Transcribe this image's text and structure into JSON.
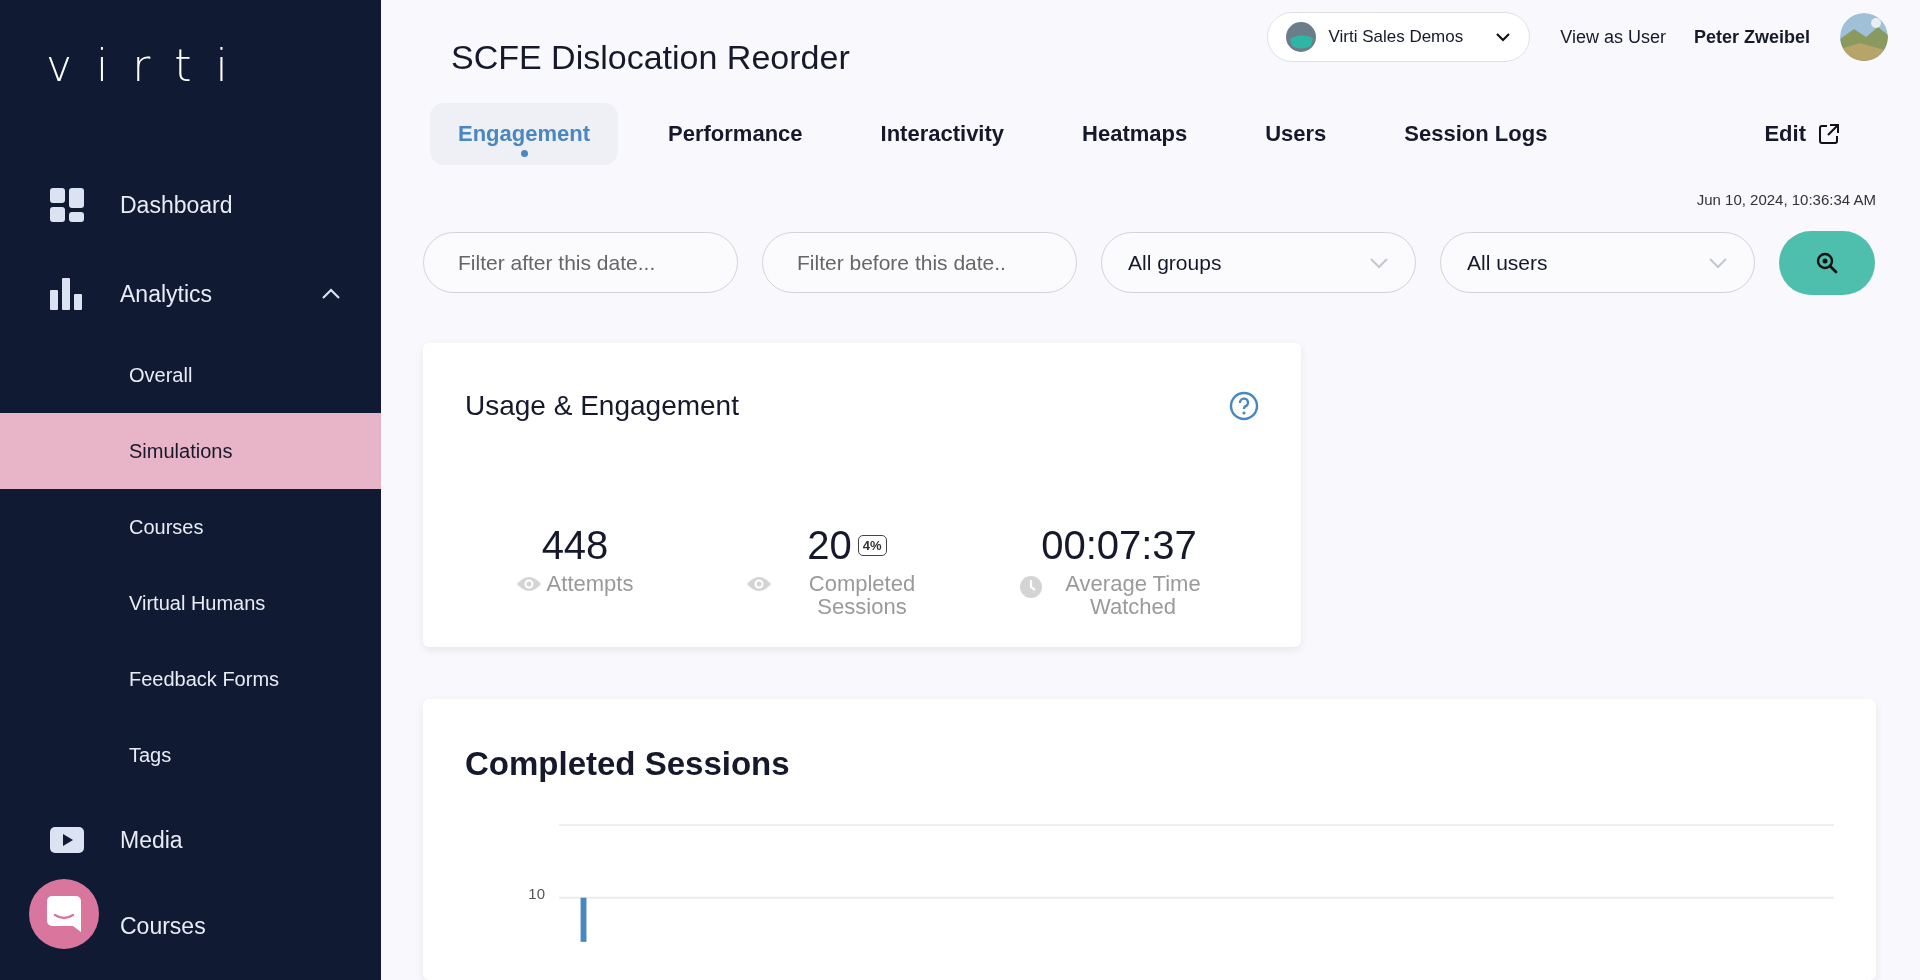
{
  "sidebar": {
    "logo": "virti",
    "items": [
      {
        "label": "Dashboard"
      },
      {
        "label": "Analytics",
        "expanded": true,
        "children": [
          {
            "label": "Overall",
            "selected": false
          },
          {
            "label": "Simulations",
            "selected": true
          },
          {
            "label": "Courses",
            "selected": false
          },
          {
            "label": "Virtual Humans",
            "selected": false
          },
          {
            "label": "Feedback Forms",
            "selected": false
          },
          {
            "label": "Tags",
            "selected": false
          }
        ]
      },
      {
        "label": "Media"
      },
      {
        "label": "Courses"
      }
    ]
  },
  "header": {
    "title": "SCFE Dislocation Reorder",
    "org_selector": "Virti Sales Demos",
    "view_as_user": "View as User",
    "user_name": "Peter Zweibel"
  },
  "tabs": [
    {
      "label": "Engagement",
      "selected": true
    },
    {
      "label": "Performance",
      "selected": false
    },
    {
      "label": "Interactivity",
      "selected": false
    },
    {
      "label": "Heatmaps",
      "selected": false
    },
    {
      "label": "Users",
      "selected": false
    },
    {
      "label": "Session Logs",
      "selected": false
    }
  ],
  "edit_link": "Edit",
  "timestamp": "Jun 10, 2024, 10:36:34 AM",
  "filters": [
    {
      "kind": "date",
      "placeholder": "Filter after this date..."
    },
    {
      "kind": "date",
      "placeholder": "Filter before this date.."
    },
    {
      "kind": "select",
      "value": "All groups"
    },
    {
      "kind": "select",
      "value": "All users"
    }
  ],
  "usage": {
    "title": "Usage & Engagement",
    "stats": [
      {
        "value": "448",
        "label": "Attempts"
      },
      {
        "value": "20",
        "badge": "4%",
        "label": "Completed Sessions"
      },
      {
        "value": "00:07:37",
        "label": "Average Time Watched"
      }
    ]
  },
  "completed_sessions": {
    "title": "Completed Sessions",
    "y_tick": "10"
  }
}
